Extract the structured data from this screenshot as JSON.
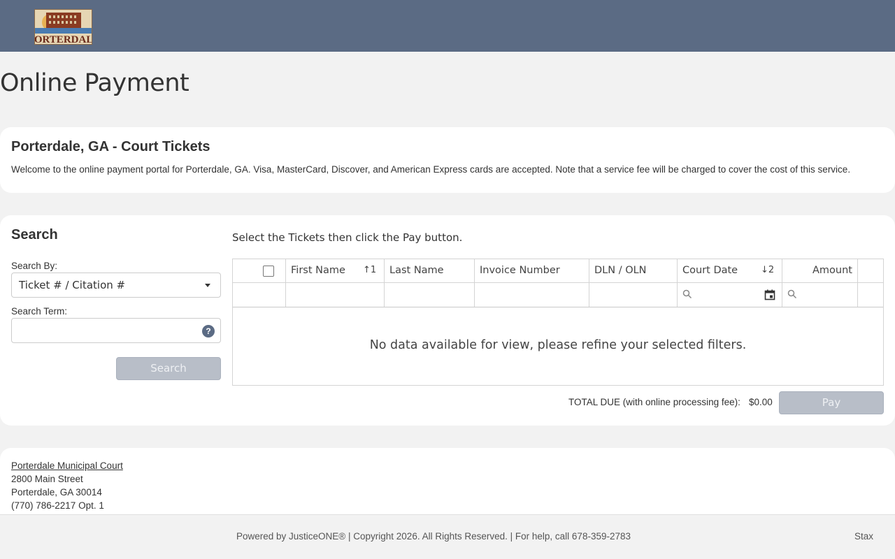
{
  "header": {
    "logo_text": "PORTERDALE"
  },
  "page_title": "Online Payment",
  "intro": {
    "title": "Porterdale, GA - Court Tickets",
    "text": "Welcome to the online payment portal for Porterdale, GA. Visa, MasterCard, Discover, and American Express cards are accepted. Note that a service fee will be charged to cover the cost of this service."
  },
  "search": {
    "title": "Search",
    "search_by_label": "Search By:",
    "search_by_value": "Ticket # / Citation #",
    "search_term_label": "Search Term:",
    "search_term_value": "",
    "help_icon": "?",
    "button_label": "Search"
  },
  "results": {
    "instruction": "Select the Tickets then click the Pay button.",
    "columns": [
      {
        "label": "First Name",
        "sort": "↑1"
      },
      {
        "label": "Last Name",
        "sort": ""
      },
      {
        "label": "Invoice Number",
        "sort": ""
      },
      {
        "label": "DLN / OLN",
        "sort": ""
      },
      {
        "label": "Court Date",
        "sort": "↓2"
      },
      {
        "label": "Amount",
        "sort": ""
      }
    ],
    "empty_message": "No data available for view, please refine your selected filters.",
    "total_label": "TOTAL DUE (with online processing fee):",
    "total_value": "$0.00",
    "pay_label": "Pay"
  },
  "court": {
    "name": "Porterdale Municipal Court",
    "street": "2800 Main Street",
    "city": "Porterdale, GA 30014",
    "phone": "(770) 786-2217 Opt. 1"
  },
  "footer": {
    "text": "Powered by JusticeONE® | Copyright 2026. All Rights Reserved. | For help, call 678-359-2783",
    "right": "Stax"
  },
  "colors": {
    "header_bg": "#5b6b84",
    "button_disabled": "#b8bec8",
    "page_bg": "#f2f2f2"
  }
}
